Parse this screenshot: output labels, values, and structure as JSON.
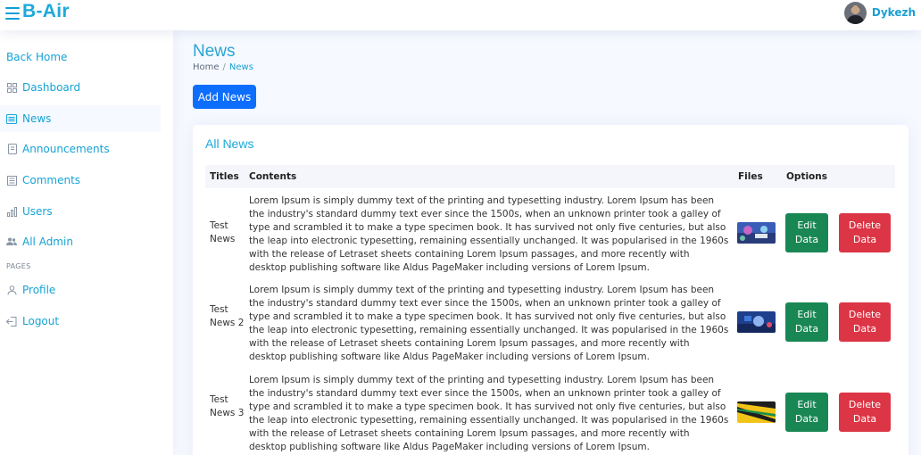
{
  "header": {
    "brand": "B-Air",
    "user_name": "Dykezh",
    "accent_color": "#1ca9da"
  },
  "sidebar": {
    "back_home": "Back Home",
    "items": [
      {
        "label": "Dashboard",
        "icon": "grid-icon"
      },
      {
        "label": "News",
        "icon": "newspaper-icon"
      },
      {
        "label": "Announcements",
        "icon": "journal-icon"
      },
      {
        "label": "Comments",
        "icon": "layout-text-icon"
      },
      {
        "label": "Users",
        "icon": "bar-chart-icon"
      },
      {
        "label": "All Admin",
        "icon": "people-icon"
      }
    ],
    "pages_heading": "PAGES",
    "profile": "Profile",
    "logout": "Logout"
  },
  "page": {
    "title": "News",
    "breadcrumb_home": "Home",
    "breadcrumb_sep": "/",
    "breadcrumb_current": "News",
    "add_button": "Add News"
  },
  "card": {
    "title": "All News",
    "columns": [
      "Titles",
      "Contents",
      "Files",
      "Options"
    ],
    "rows": [
      {
        "title": "Test News",
        "content": "Lorem Ipsum is simply dummy text of the printing and typesetting industry. Lorem Ipsum has been the industry's standard dummy text ever since the 1500s, when an unknown printer took a galley of type and scrambled it to make a type specimen book. It has survived not only five centuries, but also the leap into electronic typesetting, remaining essentially unchanged. It was popularised in the 1960s with the release of Letraset sheets containing Lorem Ipsum passages, and more recently with desktop publishing software like Aldus PageMaker including versions of Lorem Ipsum.",
        "edit": "Edit Data",
        "delete": "Delete Data"
      },
      {
        "title": "Test News 2",
        "content": "Lorem Ipsum is simply dummy text of the printing and typesetting industry. Lorem Ipsum has been the industry's standard dummy text ever since the 1500s, when an unknown printer took a galley of type and scrambled it to make a type specimen book. It has survived not only five centuries, but also the leap into electronic typesetting, remaining essentially unchanged. It was popularised in the 1960s with the release of Letraset sheets containing Lorem Ipsum passages, and more recently with desktop publishing software like Aldus PageMaker including versions of Lorem Ipsum.",
        "edit": "Edit Data",
        "delete": "Delete Data"
      },
      {
        "title": "Test News 3",
        "content": "Lorem Ipsum is simply dummy text of the printing and typesetting industry. Lorem Ipsum has been the industry's standard dummy text ever since the 1500s, when an unknown printer took a galley of type and scrambled it to make a type specimen book. It has survived not only five centuries, but also the leap into electronic typesetting, remaining essentially unchanged. It was popularised in the 1960s with the release of Letraset sheets containing Lorem Ipsum passages, and more recently with desktop publishing software like Aldus PageMaker including versions of Lorem Ipsum.",
        "edit": "Edit Data",
        "delete": "Delete Data"
      }
    ]
  }
}
